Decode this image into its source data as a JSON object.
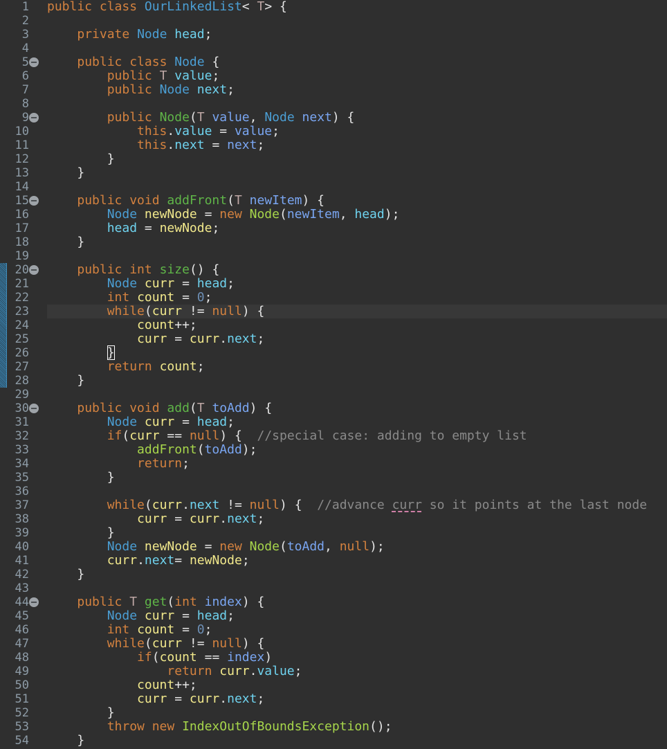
{
  "editor": {
    "language": "Java",
    "current_line": 23,
    "changed_lines_range": [
      20,
      28
    ],
    "folding_markers": [
      5,
      9,
      15,
      20,
      30,
      44
    ],
    "bracket_match_line": 26,
    "spellcheck_word": "curr",
    "lines": [
      {
        "n": "1",
        "t": [
          [
            "kw",
            "public class "
          ],
          [
            "ty",
            "OurLinkedList"
          ],
          [
            "op",
            "< "
          ],
          [
            "tp",
            "T"
          ],
          [
            "op",
            "> {"
          ]
        ]
      },
      {
        "n": "2",
        "t": []
      },
      {
        "n": "3",
        "t": [
          [
            "op",
            "    "
          ],
          [
            "kw",
            "private "
          ],
          [
            "ty",
            "Node "
          ],
          [
            "fd",
            "head"
          ],
          [
            "op",
            ";"
          ]
        ]
      },
      {
        "n": "4",
        "t": []
      },
      {
        "n": "5",
        "t": [
          [
            "op",
            "    "
          ],
          [
            "kw",
            "public class "
          ],
          [
            "ty",
            "Node"
          ],
          [
            "op",
            " {"
          ]
        ]
      },
      {
        "n": "6",
        "t": [
          [
            "op",
            "        "
          ],
          [
            "kw",
            "public "
          ],
          [
            "tp",
            "T "
          ],
          [
            "fd",
            "value"
          ],
          [
            "op",
            ";"
          ]
        ]
      },
      {
        "n": "7",
        "t": [
          [
            "op",
            "        "
          ],
          [
            "kw",
            "public "
          ],
          [
            "ty",
            "Node "
          ],
          [
            "fd",
            "next"
          ],
          [
            "op",
            ";"
          ]
        ]
      },
      {
        "n": "8",
        "t": []
      },
      {
        "n": "9",
        "t": [
          [
            "op",
            "        "
          ],
          [
            "kw",
            "public "
          ],
          [
            "md",
            "Node"
          ],
          [
            "op",
            "("
          ],
          [
            "tp",
            "T "
          ],
          [
            "pa",
            "value"
          ],
          [
            "op",
            ", "
          ],
          [
            "ty",
            "Node "
          ],
          [
            "pa",
            "next"
          ],
          [
            "op",
            ") {"
          ]
        ]
      },
      {
        "n": "10",
        "t": [
          [
            "op",
            "            "
          ],
          [
            "kw",
            "this"
          ],
          [
            "op",
            "."
          ],
          [
            "fd",
            "value"
          ],
          [
            "op",
            " = "
          ],
          [
            "pa",
            "value"
          ],
          [
            "op",
            ";"
          ]
        ]
      },
      {
        "n": "11",
        "t": [
          [
            "op",
            "            "
          ],
          [
            "kw",
            "this"
          ],
          [
            "op",
            "."
          ],
          [
            "fd",
            "next"
          ],
          [
            "op",
            " = "
          ],
          [
            "pa",
            "next"
          ],
          [
            "op",
            ";"
          ]
        ]
      },
      {
        "n": "12",
        "t": [
          [
            "op",
            "        }"
          ]
        ]
      },
      {
        "n": "13",
        "t": [
          [
            "op",
            "    }"
          ]
        ]
      },
      {
        "n": "14",
        "t": []
      },
      {
        "n": "15",
        "t": [
          [
            "op",
            "    "
          ],
          [
            "kw",
            "public void "
          ],
          [
            "md",
            "addFront"
          ],
          [
            "op",
            "("
          ],
          [
            "tp",
            "T "
          ],
          [
            "pa",
            "newItem"
          ],
          [
            "op",
            ") {"
          ]
        ]
      },
      {
        "n": "16",
        "t": [
          [
            "op",
            "        "
          ],
          [
            "ty",
            "Node "
          ],
          [
            "lv",
            "newNode"
          ],
          [
            "op",
            " = "
          ],
          [
            "kw",
            "new "
          ],
          [
            "mc",
            "Node"
          ],
          [
            "op",
            "("
          ],
          [
            "pa",
            "newItem"
          ],
          [
            "op",
            ", "
          ],
          [
            "fd",
            "head"
          ],
          [
            "op",
            ");"
          ]
        ]
      },
      {
        "n": "17",
        "t": [
          [
            "op",
            "        "
          ],
          [
            "fd",
            "head"
          ],
          [
            "op",
            " = "
          ],
          [
            "lv",
            "newNode"
          ],
          [
            "op",
            ";"
          ]
        ]
      },
      {
        "n": "18",
        "t": [
          [
            "op",
            "    }"
          ]
        ]
      },
      {
        "n": "19",
        "t": []
      },
      {
        "n": "20",
        "t": [
          [
            "op",
            "    "
          ],
          [
            "kw",
            "public int "
          ],
          [
            "md",
            "size"
          ],
          [
            "op",
            "() {"
          ]
        ]
      },
      {
        "n": "21",
        "t": [
          [
            "op",
            "        "
          ],
          [
            "ty",
            "Node "
          ],
          [
            "lv",
            "curr"
          ],
          [
            "op",
            " = "
          ],
          [
            "fd",
            "head"
          ],
          [
            "op",
            ";"
          ]
        ]
      },
      {
        "n": "22",
        "t": [
          [
            "op",
            "        "
          ],
          [
            "kw",
            "int "
          ],
          [
            "lv",
            "count"
          ],
          [
            "op",
            " = "
          ],
          [
            "nu",
            "0"
          ],
          [
            "op",
            ";"
          ]
        ]
      },
      {
        "n": "23",
        "t": [
          [
            "op",
            "        "
          ],
          [
            "kw",
            "while"
          ],
          [
            "op",
            "("
          ],
          [
            "lv",
            "curr"
          ],
          [
            "op",
            " != "
          ],
          [
            "kw",
            "null"
          ],
          [
            "op",
            ") {"
          ]
        ]
      },
      {
        "n": "24",
        "t": [
          [
            "op",
            "            "
          ],
          [
            "lv",
            "count"
          ],
          [
            "op",
            "++;"
          ]
        ]
      },
      {
        "n": "25",
        "t": [
          [
            "op",
            "            "
          ],
          [
            "lv",
            "curr"
          ],
          [
            "op",
            " = "
          ],
          [
            "lv",
            "curr"
          ],
          [
            "op",
            "."
          ],
          [
            "fd",
            "next"
          ],
          [
            "op",
            ";"
          ]
        ]
      },
      {
        "n": "26",
        "t": [
          [
            "op",
            "        "
          ],
          [
            "bm",
            "}"
          ]
        ]
      },
      {
        "n": "27",
        "t": [
          [
            "op",
            "        "
          ],
          [
            "kw",
            "return "
          ],
          [
            "lv",
            "count"
          ],
          [
            "op",
            ";"
          ]
        ]
      },
      {
        "n": "28",
        "t": [
          [
            "op",
            "    }"
          ]
        ]
      },
      {
        "n": "29",
        "t": []
      },
      {
        "n": "30",
        "t": [
          [
            "op",
            "    "
          ],
          [
            "kw",
            "public void "
          ],
          [
            "md",
            "add"
          ],
          [
            "op",
            "("
          ],
          [
            "tp",
            "T "
          ],
          [
            "pa",
            "toAdd"
          ],
          [
            "op",
            ") {"
          ]
        ]
      },
      {
        "n": "31",
        "t": [
          [
            "op",
            "        "
          ],
          [
            "ty",
            "Node "
          ],
          [
            "lv",
            "curr"
          ],
          [
            "op",
            " = "
          ],
          [
            "fd",
            "head"
          ],
          [
            "op",
            ";"
          ]
        ]
      },
      {
        "n": "32",
        "t": [
          [
            "op",
            "        "
          ],
          [
            "kw",
            "if"
          ],
          [
            "op",
            "("
          ],
          [
            "lv",
            "curr"
          ],
          [
            "op",
            " == "
          ],
          [
            "kw",
            "null"
          ],
          [
            "op",
            ") {  "
          ],
          [
            "cm",
            "//special case: adding to empty list"
          ]
        ]
      },
      {
        "n": "33",
        "t": [
          [
            "op",
            "            "
          ],
          [
            "mc",
            "addFront"
          ],
          [
            "op",
            "("
          ],
          [
            "pa",
            "toAdd"
          ],
          [
            "op",
            ");"
          ]
        ]
      },
      {
        "n": "34",
        "t": [
          [
            "op",
            "            "
          ],
          [
            "kw",
            "return"
          ],
          [
            "op",
            ";"
          ]
        ]
      },
      {
        "n": "35",
        "t": [
          [
            "op",
            "        }"
          ]
        ]
      },
      {
        "n": "36",
        "t": []
      },
      {
        "n": "37",
        "t": [
          [
            "op",
            "        "
          ],
          [
            "kw",
            "while"
          ],
          [
            "op",
            "("
          ],
          [
            "lv",
            "curr"
          ],
          [
            "op",
            "."
          ],
          [
            "fd",
            "next"
          ],
          [
            "op",
            " != "
          ],
          [
            "kw",
            "null"
          ],
          [
            "op",
            ") {  "
          ],
          [
            "cm",
            "//advance "
          ],
          [
            "cs",
            "curr"
          ],
          [
            "cm",
            " so it points at the last node"
          ]
        ]
      },
      {
        "n": "38",
        "t": [
          [
            "op",
            "            "
          ],
          [
            "lv",
            "curr"
          ],
          [
            "op",
            " = "
          ],
          [
            "lv",
            "curr"
          ],
          [
            "op",
            "."
          ],
          [
            "fd",
            "next"
          ],
          [
            "op",
            ";"
          ]
        ]
      },
      {
        "n": "39",
        "t": [
          [
            "op",
            "        }"
          ]
        ]
      },
      {
        "n": "40",
        "t": [
          [
            "op",
            "        "
          ],
          [
            "ty",
            "Node "
          ],
          [
            "lv",
            "newNode"
          ],
          [
            "op",
            " = "
          ],
          [
            "kw",
            "new "
          ],
          [
            "mc",
            "Node"
          ],
          [
            "op",
            "("
          ],
          [
            "pa",
            "toAdd"
          ],
          [
            "op",
            ", "
          ],
          [
            "kw",
            "null"
          ],
          [
            "op",
            ");"
          ]
        ]
      },
      {
        "n": "41",
        "t": [
          [
            "op",
            "        "
          ],
          [
            "lv",
            "curr"
          ],
          [
            "op",
            "."
          ],
          [
            "fd",
            "next"
          ],
          [
            "op",
            "= "
          ],
          [
            "lv",
            "newNode"
          ],
          [
            "op",
            ";"
          ]
        ]
      },
      {
        "n": "42",
        "t": [
          [
            "op",
            "    }"
          ]
        ]
      },
      {
        "n": "43",
        "t": []
      },
      {
        "n": "44",
        "t": [
          [
            "op",
            "    "
          ],
          [
            "kw",
            "public "
          ],
          [
            "tp",
            "T "
          ],
          [
            "md",
            "get"
          ],
          [
            "op",
            "("
          ],
          [
            "kw",
            "int "
          ],
          [
            "pa",
            "index"
          ],
          [
            "op",
            ") {"
          ]
        ]
      },
      {
        "n": "45",
        "t": [
          [
            "op",
            "        "
          ],
          [
            "ty",
            "Node "
          ],
          [
            "lv",
            "curr"
          ],
          [
            "op",
            " = "
          ],
          [
            "fd",
            "head"
          ],
          [
            "op",
            ";"
          ]
        ]
      },
      {
        "n": "46",
        "t": [
          [
            "op",
            "        "
          ],
          [
            "kw",
            "int "
          ],
          [
            "lv",
            "count"
          ],
          [
            "op",
            " = "
          ],
          [
            "nu",
            "0"
          ],
          [
            "op",
            ";"
          ]
        ]
      },
      {
        "n": "47",
        "t": [
          [
            "op",
            "        "
          ],
          [
            "kw",
            "while"
          ],
          [
            "op",
            "("
          ],
          [
            "lv",
            "curr"
          ],
          [
            "op",
            " != "
          ],
          [
            "kw",
            "null"
          ],
          [
            "op",
            ") {"
          ]
        ]
      },
      {
        "n": "48",
        "t": [
          [
            "op",
            "            "
          ],
          [
            "kw",
            "if"
          ],
          [
            "op",
            "("
          ],
          [
            "lv",
            "count"
          ],
          [
            "op",
            " == "
          ],
          [
            "pa",
            "index"
          ],
          [
            "op",
            ")"
          ]
        ]
      },
      {
        "n": "49",
        "t": [
          [
            "op",
            "                "
          ],
          [
            "kw",
            "return "
          ],
          [
            "lv",
            "curr"
          ],
          [
            "op",
            "."
          ],
          [
            "fd",
            "value"
          ],
          [
            "op",
            ";"
          ]
        ]
      },
      {
        "n": "50",
        "t": [
          [
            "op",
            "            "
          ],
          [
            "lv",
            "count"
          ],
          [
            "op",
            "++;"
          ]
        ]
      },
      {
        "n": "51",
        "t": [
          [
            "op",
            "            "
          ],
          [
            "lv",
            "curr"
          ],
          [
            "op",
            " = "
          ],
          [
            "lv",
            "curr"
          ],
          [
            "op",
            "."
          ],
          [
            "fd",
            "next"
          ],
          [
            "op",
            ";"
          ]
        ]
      },
      {
        "n": "52",
        "t": [
          [
            "op",
            "        }"
          ]
        ]
      },
      {
        "n": "53",
        "t": [
          [
            "op",
            "        "
          ],
          [
            "kw",
            "throw new "
          ],
          [
            "mc",
            "IndexOutOfBoundsException"
          ],
          [
            "op",
            "();"
          ]
        ]
      },
      {
        "n": "54",
        "t": [
          [
            "op",
            "    }"
          ]
        ]
      }
    ]
  }
}
